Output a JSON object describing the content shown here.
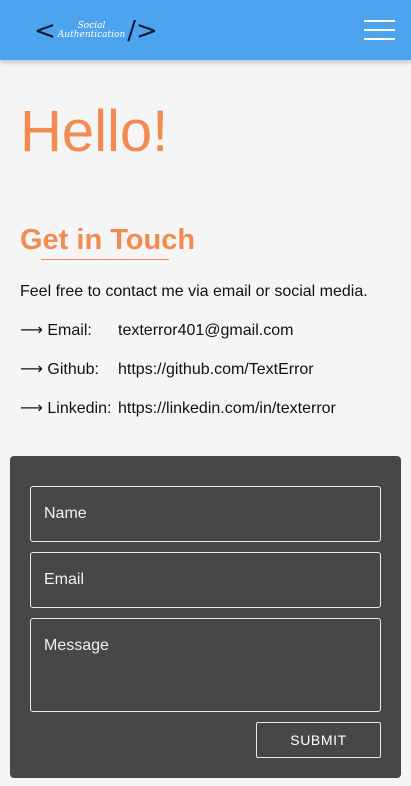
{
  "header": {
    "logo": {
      "left_bracket": "<",
      "line1": "Social",
      "line2": "Authentication",
      "right_bracket": "/>"
    },
    "menu_icon": "hamburger-menu-icon",
    "colors": {
      "background": "#4da3ee"
    }
  },
  "hero": {
    "title": "Hello!"
  },
  "contact": {
    "heading": "Get in Touch",
    "intro": "Feel free to contact me via email or social media.",
    "items": [
      {
        "label": "⟶ Email:",
        "value": "texterror401@gmail.com"
      },
      {
        "label": "⟶ Github:",
        "value": "https://github.com/TextError"
      },
      {
        "label": "⟶ Linkedin:",
        "value": "https://linkedin.com/in/texterror"
      }
    ]
  },
  "form": {
    "name_placeholder": "Name",
    "email_placeholder": "Email",
    "message_placeholder": "Message",
    "submit_label": "SUBMIT",
    "colors": {
      "card": "#474747",
      "accent": "#f28b50"
    }
  }
}
